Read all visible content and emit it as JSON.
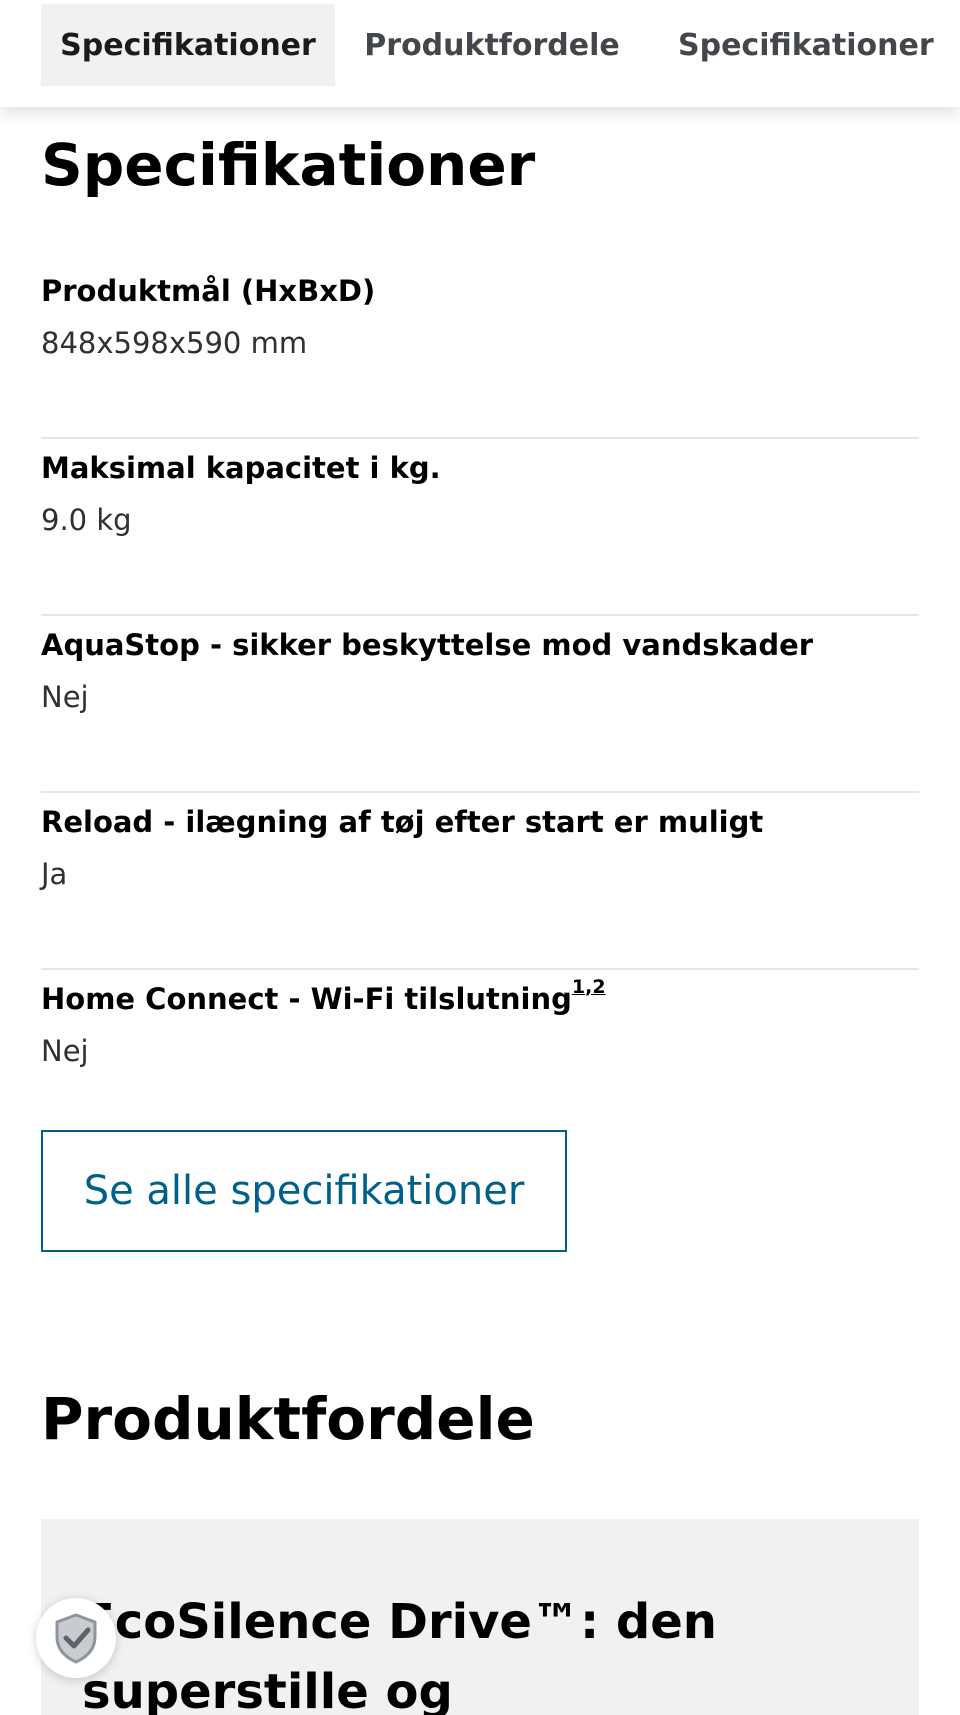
{
  "tabs": [
    {
      "label": "Specifikationer",
      "active": true
    },
    {
      "label": "Produktfordele",
      "active": false
    },
    {
      "label": "Specifikationer",
      "active": false
    }
  ],
  "specs": {
    "title": "Specifikationer",
    "items": [
      {
        "label": "Produktmål (HxBxD)",
        "value": "848x598x590 mm"
      },
      {
        "label": "Maksimal kapacitet i kg.",
        "value": "9.0 kg"
      },
      {
        "label": "AquaStop - sikker beskyttelse mod vandskader",
        "value": "Nej"
      },
      {
        "label": "Reload - ilægning af tøj efter start er muligt",
        "value": "Ja"
      },
      {
        "label": "Home Connect - Wi-Fi tilslutning",
        "footnote_1": "1",
        "footnote_sep": ",",
        "footnote_2": "2",
        "value": "Nej"
      }
    ],
    "button_label": "Se alle specifikationer"
  },
  "benefits": {
    "title": "Produktfordele",
    "card_heading": "EcoSilence Drive™: den superstille og energieffektive"
  },
  "badge": {
    "icon": "shield-check-icon"
  },
  "colors": {
    "accent": "#00608a",
    "tab_active_bg": "#eff1f2",
    "divider": "#e3e5e7"
  }
}
